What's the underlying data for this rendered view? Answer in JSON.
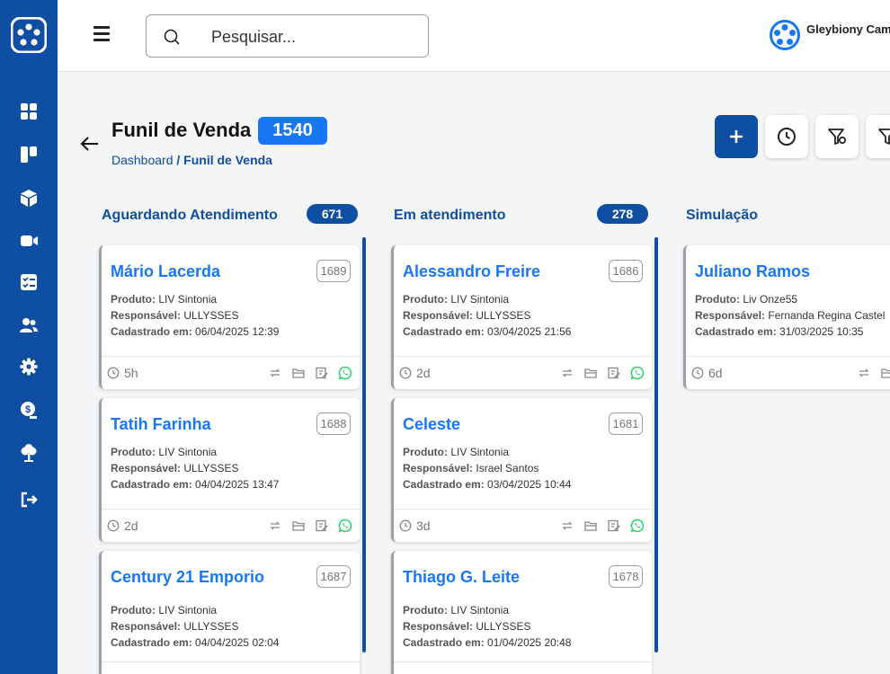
{
  "header": {
    "search_placeholder": "Pesquisar...",
    "user_name": "Gleybiony Cam"
  },
  "page": {
    "title": "Funil de Venda",
    "count": "1540",
    "breadcrumb_home": "Dashboard",
    "breadcrumb_current": "/ Funil de Venda"
  },
  "sidebar": {
    "icons": [
      "dashboard-icon",
      "kanban-icon",
      "cube-icon",
      "video-icon",
      "checklist-icon",
      "users-icon",
      "gear-icon",
      "money-icon",
      "tree-icon",
      "logout-icon"
    ]
  },
  "actions": [
    "add-icon",
    "history-icon",
    "filter-settings-icon",
    "filter-icon"
  ],
  "labels": {
    "produto": "Produto:",
    "responsavel": "Responsável:",
    "cadastrado": "Cadastrado em:"
  },
  "columns": [
    {
      "title": "Aguardando Atendimento",
      "count": "671",
      "cards": [
        {
          "name": "Mário Lacerda",
          "id": "1689",
          "produto": "LIV Sintonia",
          "responsavel": "ULLYSSES",
          "cadastrado": "06/04/2025 12:39",
          "time": "5h"
        },
        {
          "name": "Tatih Farinha",
          "id": "1688",
          "produto": "LIV Sintonia",
          "responsavel": "ULLYSSES",
          "cadastrado": "04/04/2025 13:47",
          "time": "2d"
        },
        {
          "name": "Century 21 Emporio",
          "id": "1687",
          "produto": "LIV Sintonia",
          "responsavel": "ULLYSSES",
          "cadastrado": "04/04/2025 02:04",
          "time": ""
        }
      ]
    },
    {
      "title": "Em atendimento",
      "count": "278",
      "cards": [
        {
          "name": "Alessandro Freire",
          "id": "1686",
          "produto": "LIV Sintonia",
          "responsavel": "ULLYSSES",
          "cadastrado": "03/04/2025 21:56",
          "time": "2d"
        },
        {
          "name": "Celeste",
          "id": "1681",
          "produto": "LIV Sintonia",
          "responsavel": "Israel Santos",
          "cadastrado": "03/04/2025 10:44",
          "time": "3d"
        },
        {
          "name": "Thiago G. Leite",
          "id": "1678",
          "produto": "LIV Sintonia",
          "responsavel": "ULLYSSES",
          "cadastrado": "01/04/2025 20:48",
          "time": ""
        }
      ]
    },
    {
      "title": "Simulação",
      "count": "",
      "cards": [
        {
          "name": "Juliano Ramos",
          "id": "",
          "produto": "Liv Onze55",
          "responsavel": "Fernanda Regina Castel",
          "cadastrado": "31/03/2025 10:35",
          "time": "6d"
        }
      ]
    }
  ],
  "colors": {
    "sidebar": "#0e4ea3",
    "accent": "#1877f2",
    "whatsapp": "#25d366"
  }
}
